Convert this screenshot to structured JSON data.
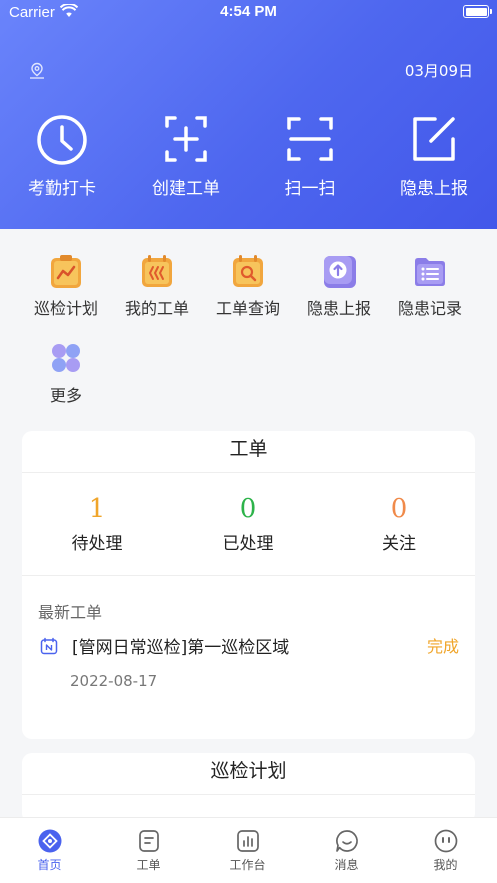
{
  "status_bar": {
    "carrier": "Carrier",
    "time": "4:54 PM"
  },
  "header": {
    "date": "03月09日"
  },
  "quick_actions": [
    {
      "label": "考勤打卡",
      "icon": "clock-icon"
    },
    {
      "label": "创建工单",
      "icon": "plus-square-icon"
    },
    {
      "label": "扫一扫",
      "icon": "scan-icon"
    },
    {
      "label": "隐患上报",
      "icon": "edit-icon"
    }
  ],
  "grid": [
    {
      "label": "巡检计划",
      "icon": "clipboard-chart-icon"
    },
    {
      "label": "我的工单",
      "icon": "calendar-icon"
    },
    {
      "label": "工单查询",
      "icon": "search-calendar-icon"
    },
    {
      "label": "隐患上报",
      "icon": "upload-icon"
    },
    {
      "label": "隐患记录",
      "icon": "folder-list-icon"
    },
    {
      "label": "更多",
      "icon": "more-icon"
    }
  ],
  "work_order_card": {
    "title": "工单",
    "stats": [
      {
        "value": "1",
        "label": "待处理",
        "color": "#f0a52a"
      },
      {
        "value": "0",
        "label": "已处理",
        "color": "#2db34a"
      },
      {
        "value": "0",
        "label": "关注",
        "color": "#f08a4a"
      }
    ],
    "latest_title": "最新工单",
    "latest": {
      "title": "[管网日常巡检]第一巡检区域",
      "status": "完成",
      "date": "2022-08-17"
    }
  },
  "plan_card": {
    "title": "巡检计划"
  },
  "tabbar": [
    {
      "label": "首页",
      "active": true
    },
    {
      "label": "工单",
      "active": false
    },
    {
      "label": "工作台",
      "active": false
    },
    {
      "label": "消息",
      "active": false
    },
    {
      "label": "我的",
      "active": false
    }
  ],
  "colors": {
    "primary": "#4e67ef",
    "accent": "#f0a52a",
    "success": "#2db34a"
  }
}
